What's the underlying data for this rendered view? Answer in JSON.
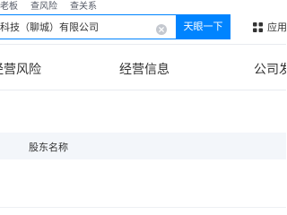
{
  "search": {
    "tabs": [
      "查老板",
      "查风险",
      "查关系"
    ],
    "query": "科技（聊城）有限公司",
    "button_label": "天眼一下"
  },
  "header": {
    "apps_label": "应用"
  },
  "nav": {
    "tabs": [
      "经营风险",
      "经营信息",
      "公司发展"
    ]
  },
  "table": {
    "columns": [
      "股东名称"
    ]
  },
  "colors": {
    "accent": "#0084ff",
    "table_header_bg": "#f3f6fa"
  },
  "icons": {
    "clear": "clear-circle-icon",
    "apps": "grid-icon"
  }
}
